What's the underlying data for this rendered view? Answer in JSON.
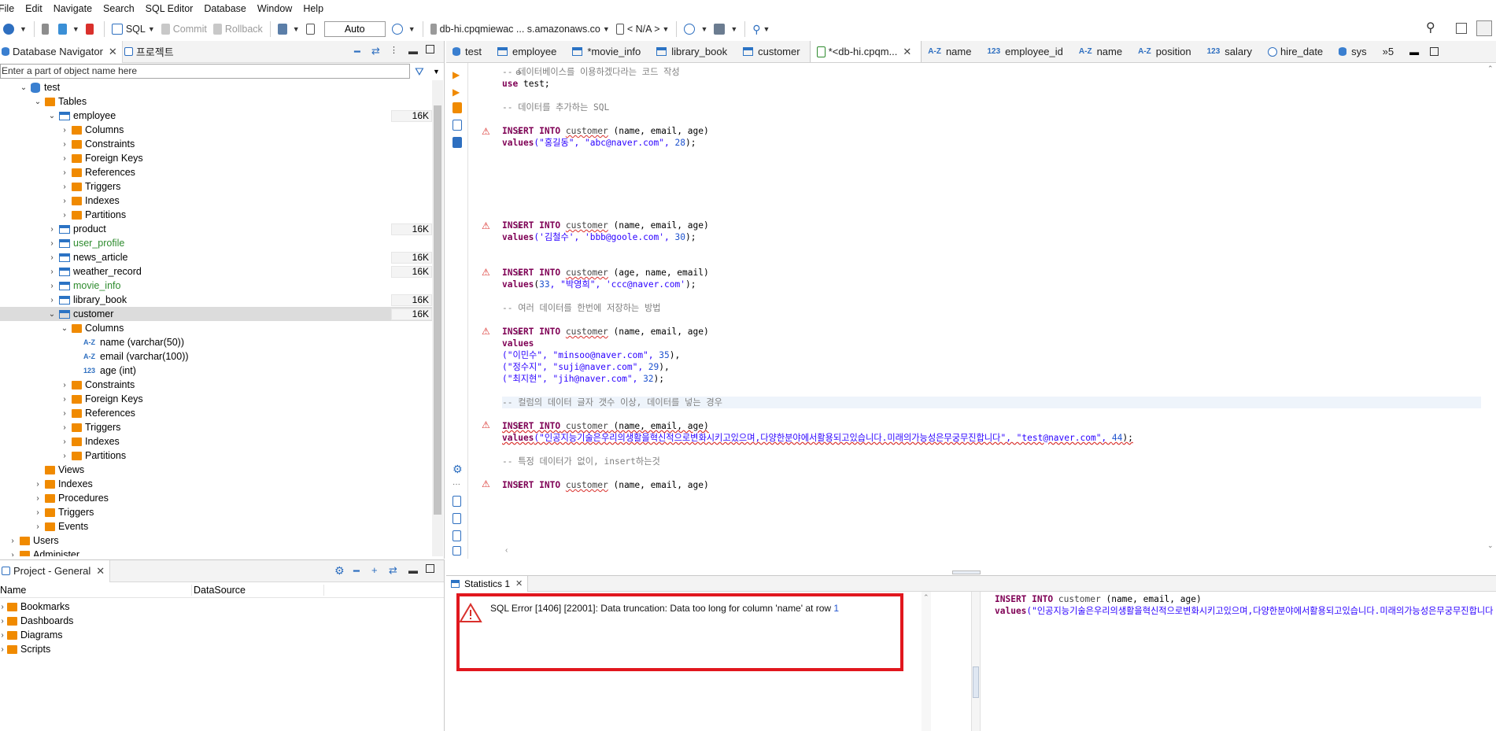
{
  "menu": [
    "File",
    "Edit",
    "Navigate",
    "Search",
    "SQL Editor",
    "Database",
    "Window",
    "Help"
  ],
  "toolbar": {
    "sql_label": "SQL",
    "commit_label": "Commit",
    "rollback_label": "Rollback",
    "mode_value": "Auto",
    "connection": "db-hi.cpqmiewac ... s.amazonaws.co",
    "schema": "< N/A >"
  },
  "navigator": {
    "tab_active": "Database Navigator",
    "tab_other": "프로젝트",
    "filter_placeholder": "Enter a part of object name here",
    "tree": {
      "db": "test",
      "tables": "Tables",
      "employee": "employee",
      "columns": "Columns",
      "constraints": "Constraints",
      "foreign_keys": "Foreign Keys",
      "references": "References",
      "triggers": "Triggers",
      "indexes": "Indexes",
      "partitions": "Partitions",
      "product": "product",
      "user_profile": "user_profile",
      "news_article": "news_article",
      "weather_record": "weather_record",
      "movie_info": "movie_info",
      "library_book": "library_book",
      "customer": "customer",
      "col_name": "name (varchar(50))",
      "col_email": "email (varchar(100))",
      "col_age": "age (int)",
      "views": "Views",
      "procedures": "Procedures",
      "triggers2": "Triggers",
      "events": "Events",
      "users": "Users",
      "administer": "Administer"
    },
    "sizes": {
      "employee": "16K",
      "product": "16K",
      "news_article": "16K",
      "weather_record": "16K",
      "library_book": "16K",
      "customer": "16K"
    }
  },
  "project": {
    "tab": "Project - General",
    "col_name": "Name",
    "col_datasource": "DataSource",
    "items": [
      "Bookmarks",
      "Dashboards",
      "Diagrams",
      "Scripts"
    ]
  },
  "editor_tabs": [
    "test",
    "employee",
    "*movie_info",
    "library_book",
    "customer",
    "*<db-hi.cpqm...",
    "name",
    "employee_id",
    "name",
    "position",
    "salary",
    "hire_date",
    "sys"
  ],
  "editor_tabs_overflow": "»5",
  "editor": {
    "lines": {
      "l1": "-- 데이터베이스를 이용하겠다라는 코드 작성",
      "l2_kw": "use",
      "l2_rest": " test;",
      "l3": "-- 데이터를 추가하는 SQL",
      "insert1_kw": "INSERT INTO",
      "insert1_tbl": "customer",
      "insert1_cols": " (name, email, age)",
      "values1_kw": "values",
      "values1_a": "(\"홍길동\", \"abc@naver.com\", ",
      "values1_num": "28",
      "values1_end": ");",
      "insert2_cols": " (name, email, age)",
      "values2_a": "('김철수', 'bbb@goole.com', ",
      "values2_num": "30",
      "values2_end": ");",
      "insert3_cols": " (age, name, email)",
      "values3_open": "(",
      "values3_num": "33",
      "values3_b": ", \"박영희\", 'ccc@naver.com'",
      "values3_end": ");",
      "cmt_multi": "-- 여러 데이터를 한번에 저장하는 방법",
      "insert4_cols": " (name, email, age)",
      "values4_kw": "values",
      "row4a": "(\"이민수\", \"minsoo@naver.com\", ",
      "row4a_num": "35",
      "row4a_end": "),",
      "row4b": "(\"정수지\", \"suji@naver.com\", ",
      "row4b_num": "29",
      "row4b_end": "),",
      "row4c": "(\"최지현\", \"jih@naver.com\", ",
      "row4c_num": "32",
      "row4c_end": ");",
      "cmt_long": "-- 컬럼의 데이터 글자 갯수 이상, 데이터를 넣는 경우",
      "insert5_cols": " (name, email, age)",
      "values5_a": "(\"인공지능기술은우리의생활을혁신적으로변화시키고있으며,다양한분야에서활용되고있습니다.미래의가능성은무궁무진합니다\", \"test@naver.com\", ",
      "values5_num": "44",
      "values5_end": ");",
      "cmt_none": "-- 특정 데이터가 없이, insert하는것",
      "insert6_cols": " (name, email, age)"
    }
  },
  "results": {
    "tab": "Statistics 1",
    "error_prefix": "SQL Error [1406] [22001]: Data truncation: Data too long for column 'name' at row ",
    "error_row": "1",
    "query_kw": "INSERT INTO",
    "query_tbl": "customer",
    "query_cols": " (name, email, age)",
    "query_values_kw": "values",
    "query_values": "(\"인공지능기술은우리의생활을혁신적으로변화시키고있으며,다양한분야에서활용되고있습니다.미래의가능성은무궁무진합니다"
  },
  "colors": {
    "accent_red": "#e1171e",
    "keyword": "#7f0055",
    "string": "#2a00ff",
    "folder": "#f08a00",
    "table_blue": "#2b73c4"
  }
}
